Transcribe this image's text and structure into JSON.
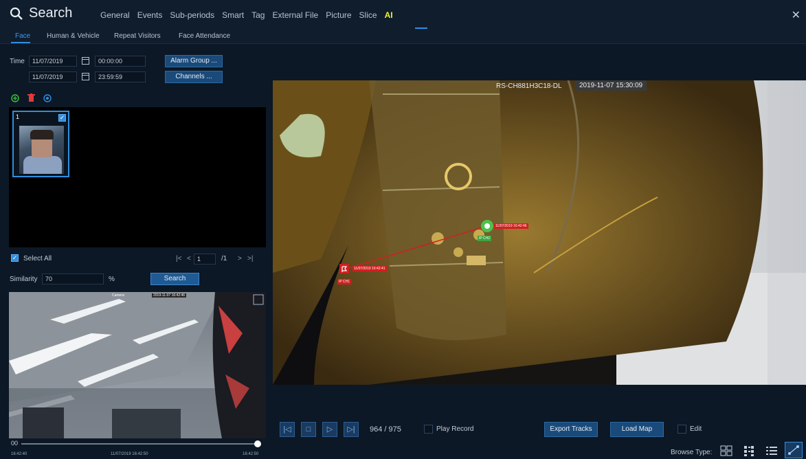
{
  "header": {
    "title": "Search",
    "tabs": [
      {
        "label": "General"
      },
      {
        "label": "Events"
      },
      {
        "label": "Sub-periods"
      },
      {
        "label": "Smart"
      },
      {
        "label": "Tag"
      },
      {
        "label": "External File"
      },
      {
        "label": "Picture"
      },
      {
        "label": "Slice"
      },
      {
        "label": "AI"
      }
    ],
    "active_tab": "AI"
  },
  "subtabs": [
    {
      "label": "Face"
    },
    {
      "label": "Human & Vehicle"
    },
    {
      "label": "Repeat Visitors"
    },
    {
      "label": "Face Attendance"
    }
  ],
  "filters": {
    "time_label": "Time",
    "start_date": "11/07/2019",
    "start_time": "00:00:00",
    "end_date": "11/07/2019",
    "end_time": "23:59:59",
    "alarm_group_button": "Alarm Group ...",
    "channels_button": "Channels ..."
  },
  "face_list": {
    "items": [
      {
        "index": "1",
        "checked": true
      }
    ],
    "select_all_label": "Select All",
    "page_current": "1",
    "page_total": "/1"
  },
  "similarity": {
    "label": "Similarity",
    "value": "70",
    "unit": "%",
    "search_button": "Search"
  },
  "preview": {
    "overlay_camera": "Camera",
    "overlay_time": "2019-11-07 16:42:46",
    "timeline_start": "16:42:40",
    "timeline_mid": "11/07/2019 16:42:50",
    "timeline_end": "16:42:50"
  },
  "video": {
    "channel_name": "RS-CH881H3C18-DL",
    "timestamp": "2019-11-07 15:30:09",
    "tracks": [
      {
        "label": "IP CH1",
        "time": "11/07/2019 16:42:41"
      },
      {
        "label": "IP CH2",
        "time": "11/07/2019 16:42:46"
      }
    ]
  },
  "playback": {
    "counter": "964 / 975",
    "play_record_label": "Play Record",
    "export_tracks_button": "Export Tracks",
    "load_map_button": "Load Map",
    "edit_label": "Edit",
    "browse_type_label": "Browse Type:"
  },
  "colors": {
    "accent": "#2f8fe0",
    "active_tab": "#f2f230",
    "track_red": "#d21f1f",
    "track_green": "#4cc24c"
  }
}
